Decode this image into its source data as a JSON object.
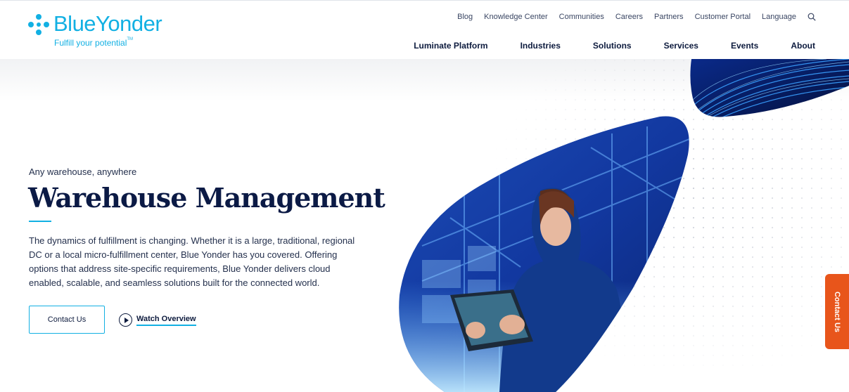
{
  "brand": {
    "name": "BlueYonder",
    "tagline": "Fulfill your potential",
    "tagline_mark": "TM",
    "color": "#12b0e3"
  },
  "utility_nav": [
    "Blog",
    "Knowledge Center",
    "Communities",
    "Careers",
    "Partners",
    "Customer Portal",
    "Language"
  ],
  "utility_icon": "search-icon",
  "main_nav": [
    "Luminate Platform",
    "Industries",
    "Solutions",
    "Services",
    "Events",
    "About"
  ],
  "hero": {
    "eyebrow": "Any warehouse, anywhere",
    "title": "Warehouse Management",
    "body": "The dynamics of fulfillment is changing. Whether it is a large, traditional, regional DC or a local micro-fulfillment center, Blue Yonder has you covered. Offering options that address site-specific requirements, Blue Yonder delivers cloud enabled, scalable, and seamless solutions built for the connected world.",
    "primary_cta": "Contact Us",
    "secondary_cta": "Watch Overview",
    "secondary_icon": "play-icon"
  },
  "side_tab": {
    "label": "Contact Us",
    "color": "#e8551b"
  },
  "colors": {
    "navy": "#0b1a45",
    "accent": "#12b0e3"
  }
}
